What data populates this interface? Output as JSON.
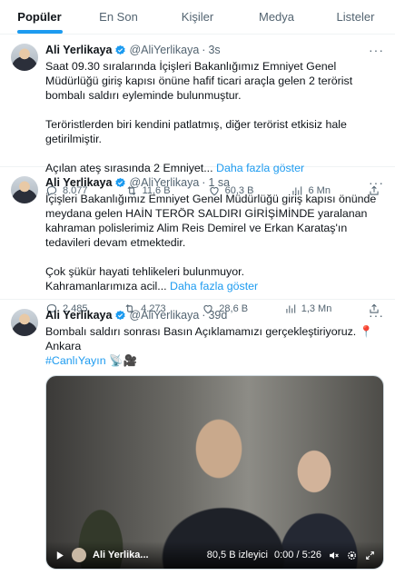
{
  "tabs": [
    {
      "label": "Popüler",
      "active": true
    },
    {
      "label": "En Son",
      "active": false
    },
    {
      "label": "Kişiler",
      "active": false
    },
    {
      "label": "Medya",
      "active": false
    },
    {
      "label": "Listeler",
      "active": false
    }
  ],
  "tweets": [
    {
      "name": "Ali Yerlikaya",
      "handle": "@AliYerlikaya",
      "time": "3s",
      "text": "Saat 09.30 sıralarında İçişleri Bakanlığımız Emniyet Genel Müdürlüğü giriş kapısı önüne hafif ticari araçla gelen 2 terörist bombalı saldırı eyleminde bulunmuştur.\n\nTeröristlerden biri kendini patlatmış, diğer terörist etkisiz hale getirilmiştir.\n\nAçılan ateş sırasında 2 Emniyet... ",
      "show_more": "Daha fazla göster",
      "replies": "8.077",
      "retweets": "11,6 B",
      "likes": "60,3 B",
      "views": "6 Mn"
    },
    {
      "name": "Ali Yerlikaya",
      "handle": "@AliYerlikaya",
      "time": "1 sa",
      "text": "İçişleri Bakanlığımız Emniyet Genel Müdürlüğü giriş kapısı önünde meydana gelen HAİN TERÖR SALDIRI GİRİŞİMİNDE yaralanan kahraman polislerimiz Alim Reis Demirel ve Erkan Karataş'ın tedavileri devam etmektedir.\n\nÇok şükür hayati tehlikeleri bulunmuyor.\nKahramanlarımıza acil... ",
      "show_more": "Daha fazla göster",
      "replies": "2.485",
      "retweets": "4.273",
      "likes": "28,6 B",
      "views": "1,3 Mn"
    },
    {
      "name": "Ali Yerlikaya",
      "handle": "@AliYerlikaya",
      "time": "39d",
      "text": "Bombalı saldırı sonrası Basın Açıklamamızı gerçekleştiriyoruz. 📍 Ankara ",
      "hashtag": "#CanlıYayın",
      "emoji": " 📡🎥",
      "video": {
        "author": "Ali Yerlika...",
        "views": "80,5 B izleyici",
        "time": "0:00 / 5:26"
      }
    }
  ]
}
